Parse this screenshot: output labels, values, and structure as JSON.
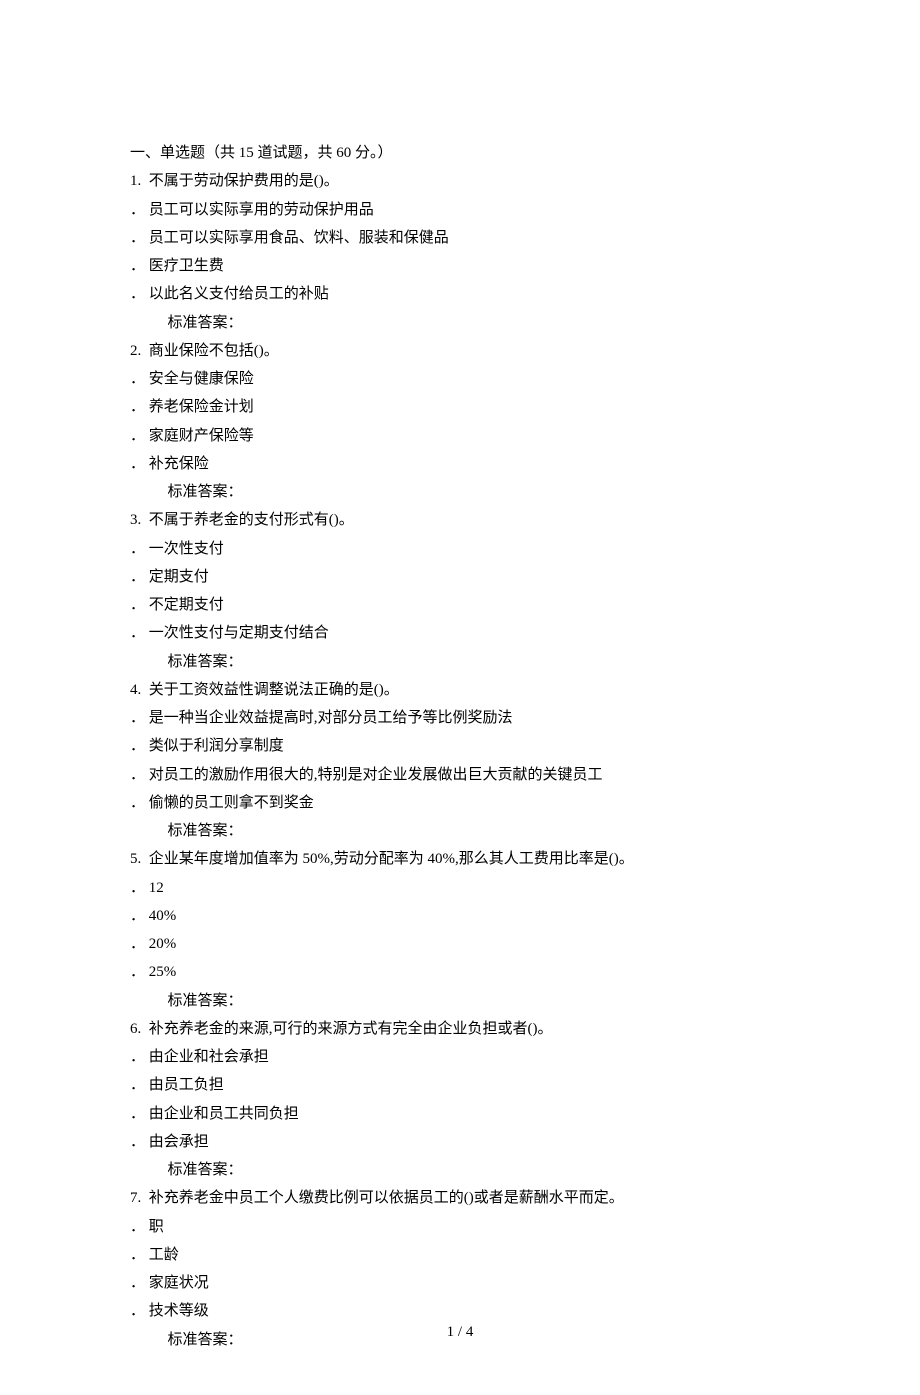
{
  "section": {
    "header": "一、单选题（共 15 道试题，共 60 分。）"
  },
  "answer_label": "标准答案：",
  "questions": [
    {
      "number": "1.",
      "stem": "不属于劳动保护费用的是()。",
      "options": [
        "． 员工可以实际享用的劳动保护用品",
        "． 员工可以实际享用食品、饮料、服装和保健品",
        "． 医疗卫生费",
        "． 以此名义支付给员工的补贴"
      ]
    },
    {
      "number": "2.",
      "stem": "商业保险不包括()。",
      "options": [
        "． 安全与健康保险",
        "． 养老保险金计划",
        "． 家庭财产保险等",
        "． 补充保险"
      ]
    },
    {
      "number": "3.",
      "stem": "不属于养老金的支付形式有()。",
      "options": [
        "． 一次性支付",
        "． 定期支付",
        "． 不定期支付",
        "． 一次性支付与定期支付结合"
      ]
    },
    {
      "number": "4.",
      "stem": "关于工资效益性调整说法正确的是()。",
      "options": [
        "． 是一种当企业效益提高时,对部分员工给予等比例奖励法",
        "． 类似于利润分享制度",
        "． 对员工的激励作用很大的,特别是对企业发展做出巨大贡献的关键员工",
        "． 偷懒的员工则拿不到奖金"
      ]
    },
    {
      "number": "5.",
      "stem": "企业某年度增加值率为 50%,劳动分配率为 40%,那么其人工费用比率是()。",
      "options": [
        "． 12",
        "． 40%",
        "． 20%",
        "． 25%"
      ]
    },
    {
      "number": "6.",
      "stem": "补充养老金的来源,可行的来源方式有完全由企业负担或者()。",
      "options": [
        "． 由企业和社会承担",
        "． 由员工负担",
        "． 由企业和员工共同负担",
        "． 由会承担"
      ]
    },
    {
      "number": "7.",
      "stem": "补充养老金中员工个人缴费比例可以依据员工的()或者是薪酬水平而定。",
      "options": [
        "． 职",
        "． 工龄",
        "． 家庭状况",
        "． 技术等级"
      ]
    }
  ],
  "pager": "1 / 4"
}
